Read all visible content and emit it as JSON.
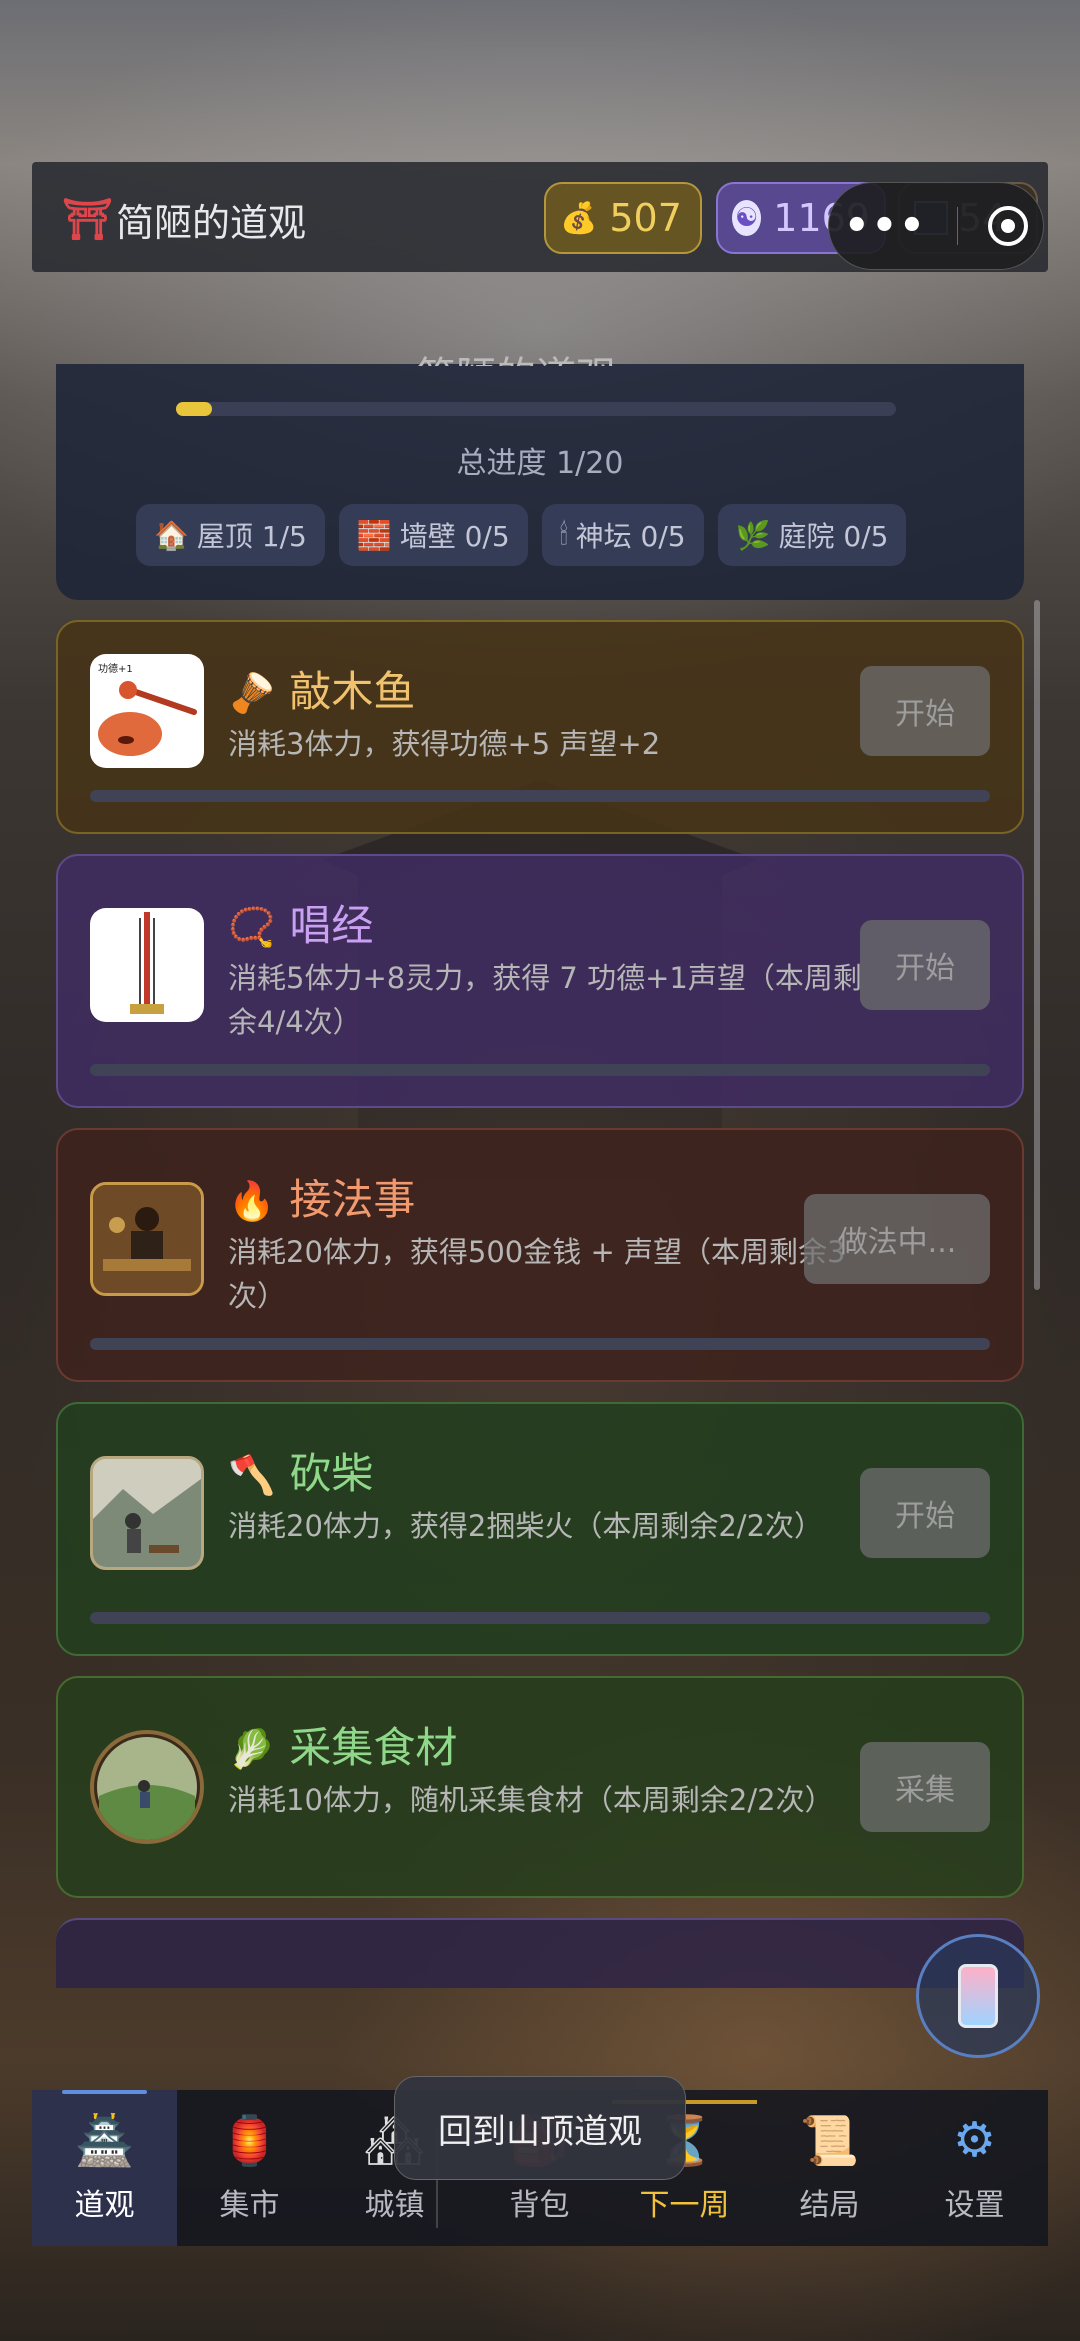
{
  "header": {
    "title": "简陋的道观",
    "gold": "507",
    "spirit": "1169",
    "reputation": "54"
  },
  "progress": {
    "cut_title": "简陋的道观",
    "fraction": 0.05,
    "total_label": "总进度 1/20",
    "parts": [
      {
        "icon": "🏠",
        "label": "屋顶 1/5"
      },
      {
        "icon": "🧱",
        "label": "墙壁 0/5"
      },
      {
        "icon": "🕯",
        "label": "神坛 0/5"
      },
      {
        "icon": "🌿",
        "label": "庭院 0/5"
      }
    ]
  },
  "activities": [
    {
      "icon": "🪘",
      "name": "敲木鱼",
      "desc": "消耗3体力，获得功德+5 声望+2",
      "button": "开始",
      "thumb_text": "功德+1"
    },
    {
      "icon": "📿",
      "name": "唱经",
      "desc": "消耗5体力+8灵力，获得 7 功德+1声望（本周剩余4/4次）",
      "button": "开始"
    },
    {
      "icon": "🔥",
      "name": "接法事",
      "desc": "消耗20体力，获得500金钱 + 声望（本周剩余3次）",
      "button": "做法中..."
    },
    {
      "icon": "🪓",
      "name": "砍柴",
      "desc": "消耗20体力，获得2捆柴火（本周剩余2/2次）",
      "button": "开始"
    },
    {
      "icon": "🥬",
      "name": "采集食材",
      "desc": "消耗10体力，随机采集食材（本周剩余2/2次）",
      "button": "采集"
    }
  ],
  "toast": "回到山顶道观",
  "nav": [
    {
      "icon": "🏯",
      "label": "道观"
    },
    {
      "icon": "🏮",
      "label": "集市"
    },
    {
      "icon": "🏘",
      "label": "城镇"
    },
    {
      "icon": "🎒",
      "label": "背包"
    },
    {
      "icon": "⏳",
      "label": "下一周"
    },
    {
      "icon": "📜",
      "label": "结局"
    },
    {
      "icon": "⚙",
      "label": "设置"
    }
  ]
}
